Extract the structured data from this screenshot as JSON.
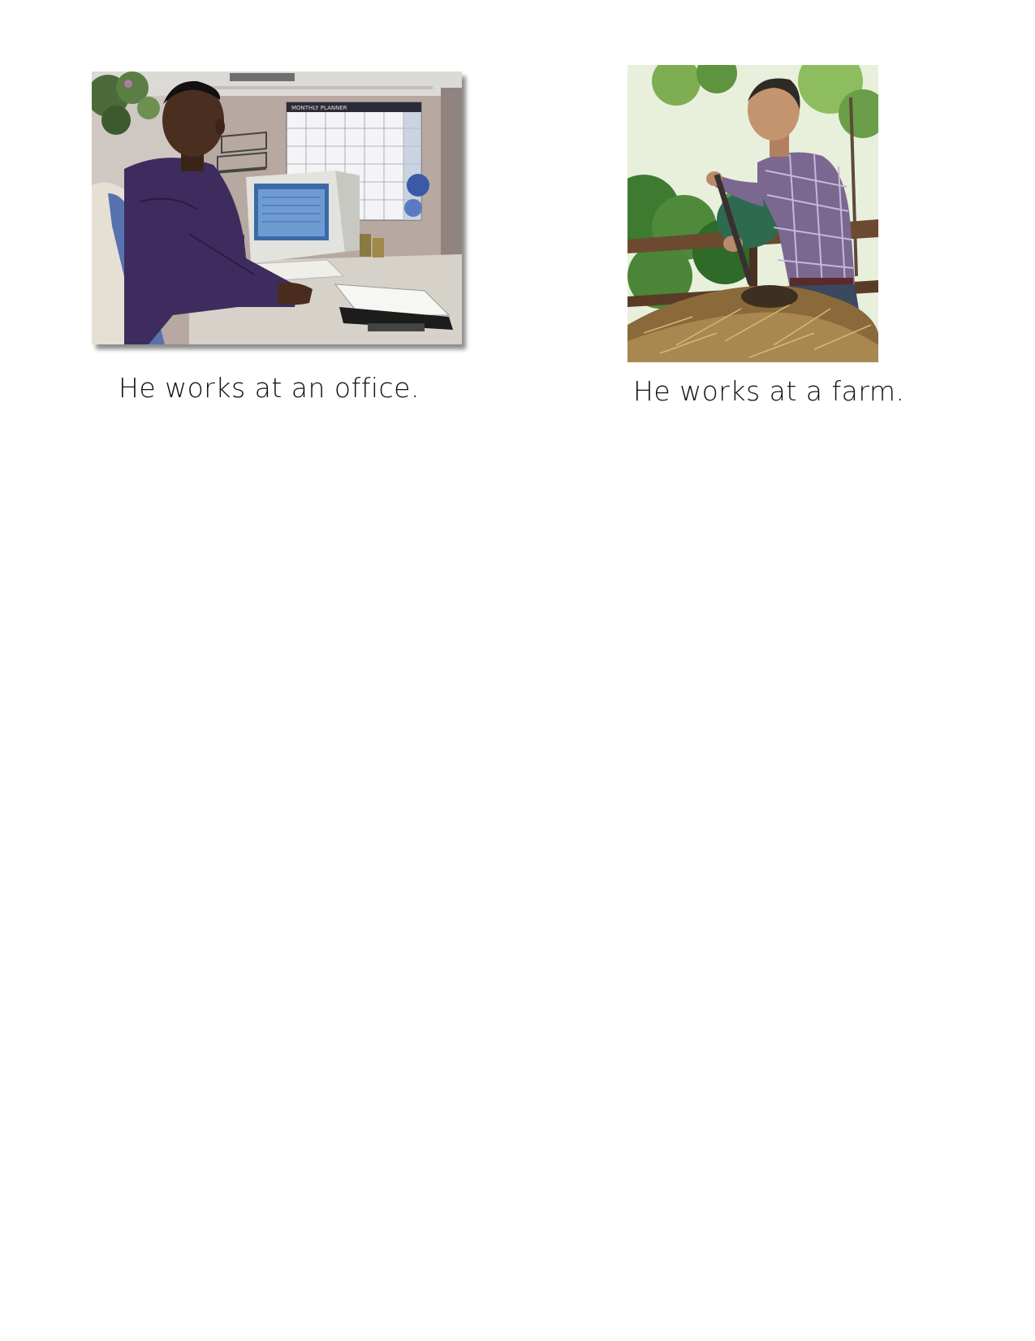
{
  "cards": [
    {
      "caption": "He works at an office.",
      "photo_subject": "man-working-at-office-computer"
    },
    {
      "caption": "He works at a farm.",
      "photo_subject": "man-working-with-pitchfork-on-farm"
    }
  ],
  "office_photo": {
    "calendar_header": "MONTHLY PLANNER"
  }
}
